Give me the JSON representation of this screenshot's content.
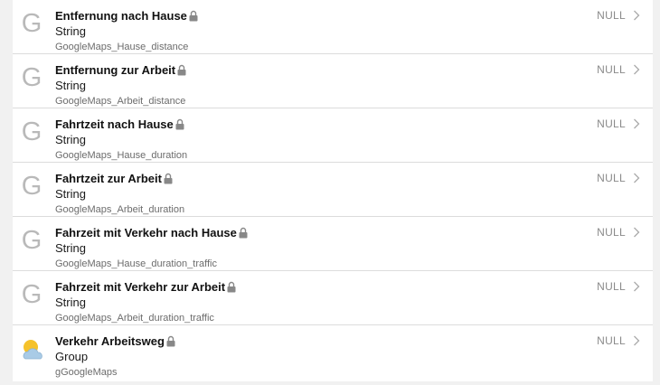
{
  "items": [
    {
      "label": "Entfernung nach Hause",
      "type": "String",
      "name": "GoogleMaps_Hause_distance",
      "state": "NULL",
      "icon": "letter-g-icon"
    },
    {
      "label": "Entfernung zur Arbeit",
      "type": "String",
      "name": "GoogleMaps_Arbeit_distance",
      "state": "NULL",
      "icon": "letter-g-icon"
    },
    {
      "label": "Fahrtzeit nach Hause",
      "type": "String",
      "name": "GoogleMaps_Hause_duration",
      "state": "NULL",
      "icon": "letter-g-icon"
    },
    {
      "label": "Fahrtzeit zur Arbeit",
      "type": "String",
      "name": "GoogleMaps_Arbeit_duration",
      "state": "NULL",
      "icon": "letter-g-icon"
    },
    {
      "label": "Fahrzeit mit Verkehr nach Hause",
      "type": "String",
      "name": "GoogleMaps_Hause_duration_traffic",
      "state": "NULL",
      "icon": "letter-g-icon"
    },
    {
      "label": "Fahrzeit mit Verkehr zur Arbeit",
      "type": "String",
      "name": "GoogleMaps_Arbeit_duration_traffic",
      "state": "NULL",
      "icon": "letter-g-icon"
    },
    {
      "label": "Verkehr Arbeitsweg",
      "type": "Group",
      "name": "gGoogleMaps",
      "state": "NULL",
      "icon": "sun-cloud-icon"
    }
  ],
  "icons": {
    "g_letter": "G",
    "lock": "lock-icon",
    "chevron": "chevron-right-icon"
  },
  "colors": {
    "title": "#111111",
    "secondary": "#6c6c6c",
    "state": "#8a8a8a",
    "lock": "#888888",
    "g_icon": "#b9b9b9",
    "sun": "#f5c22b",
    "cloud": "#a9cbe6"
  }
}
